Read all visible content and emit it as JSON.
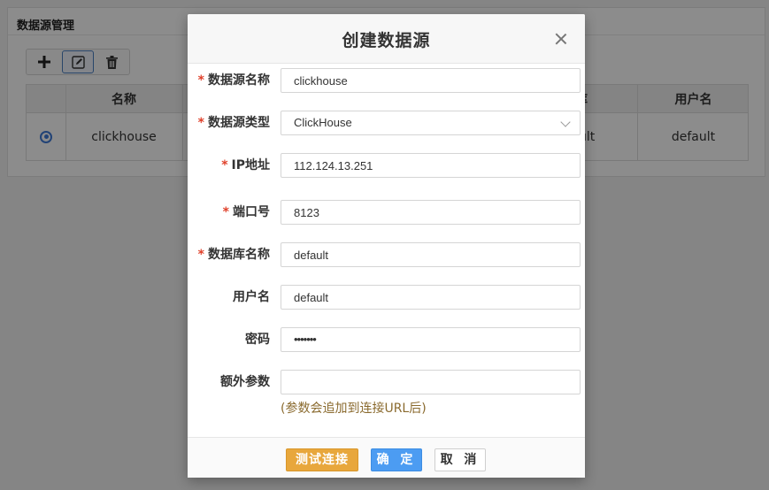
{
  "background": {
    "panel_title": "数据源管理",
    "table": {
      "columns": [
        "名称",
        "库",
        "用户名"
      ],
      "row": {
        "name": "clickhouse",
        "db_partial": "ult",
        "user": "default"
      }
    }
  },
  "dialog": {
    "title": "创建数据源",
    "fields": {
      "name": {
        "label": "数据源名称",
        "value": "clickhouse"
      },
      "type": {
        "label": "数据源类型",
        "value": "ClickHouse"
      },
      "ip": {
        "label": "IP地址",
        "value": "112.124.13.251"
      },
      "port": {
        "label": "端口号",
        "value": "8123"
      },
      "database": {
        "label": "数据库名称",
        "value": "default"
      },
      "username": {
        "label": "用户名",
        "value": "default"
      },
      "password": {
        "label": "密码",
        "value": "•••••••"
      },
      "extra": {
        "label": "额外参数",
        "value": ""
      }
    },
    "required_mark": "*",
    "hint": "(参数会追加到连接URL后)",
    "buttons": {
      "test": "测试连接",
      "ok": "确 定",
      "cancel": "取 消"
    }
  },
  "colors": {
    "primary": "#4c9cf2",
    "warning": "#e8a73c",
    "required": "#e0412b",
    "hint": "#8a6a2e"
  }
}
